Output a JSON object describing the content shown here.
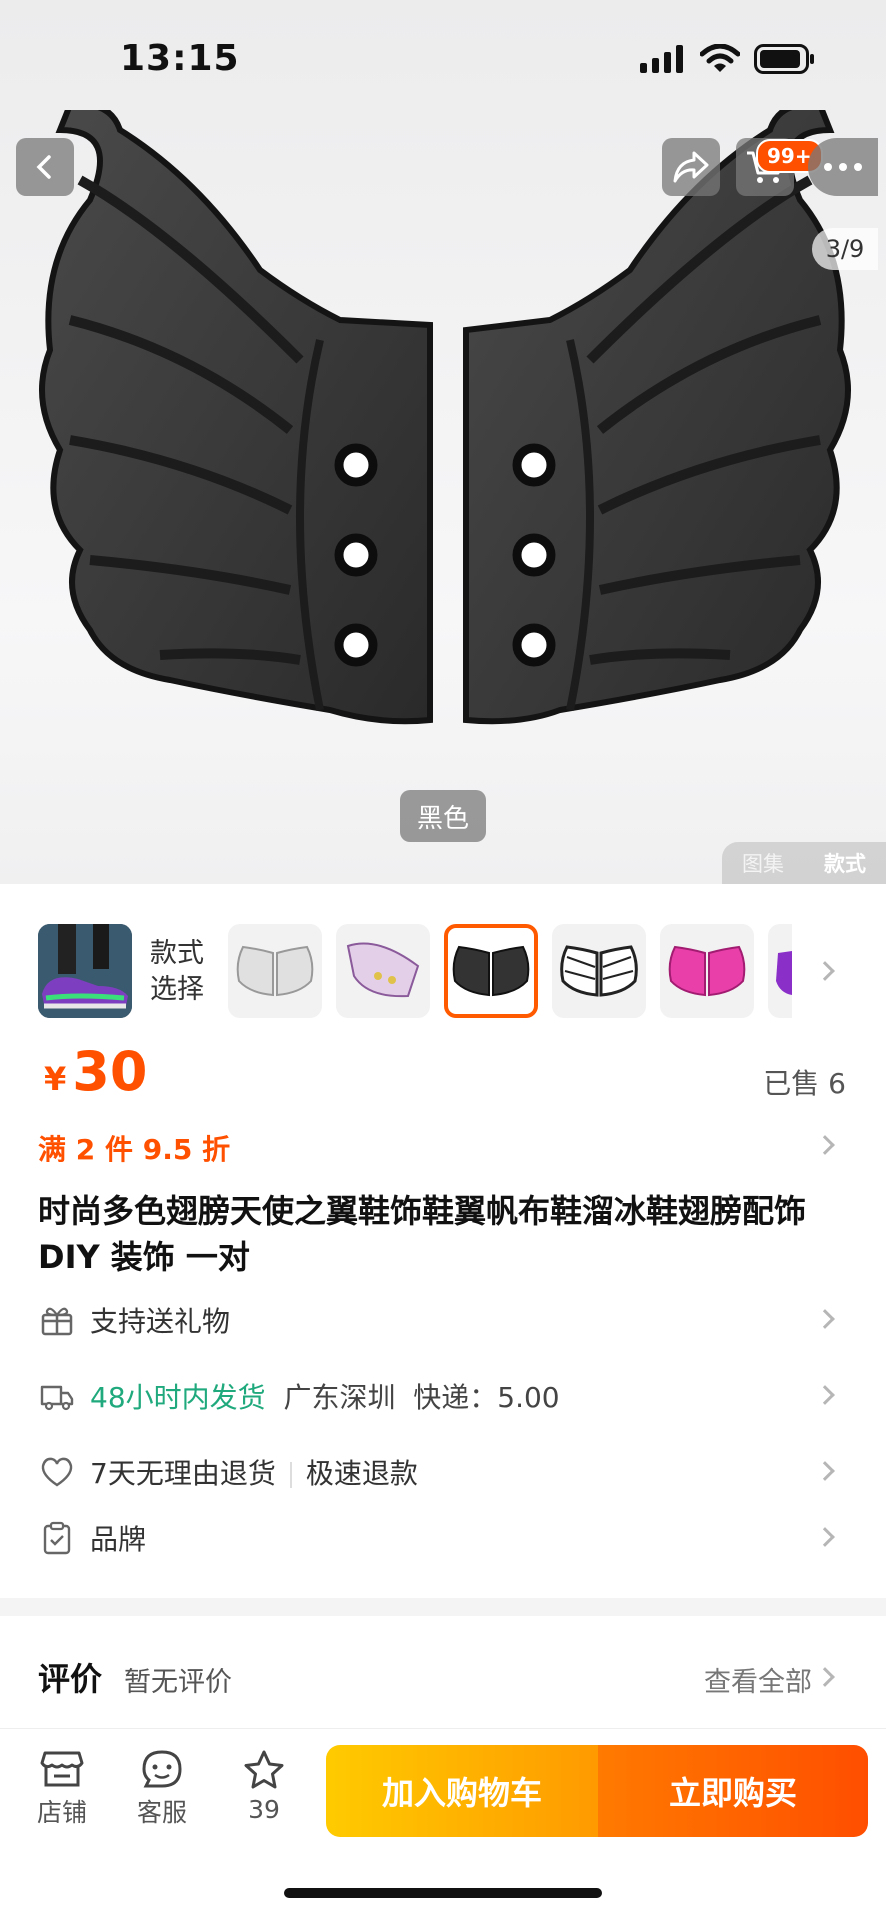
{
  "status_bar": {
    "time": "13:15"
  },
  "gallery": {
    "counter": "3/9",
    "variant_chip": "黑色",
    "tabs": [
      "图集",
      "款式"
    ],
    "cart_badge": "99+"
  },
  "style_selector": {
    "label": "款式\n选择",
    "options": [
      "white-wings",
      "lilac-wings",
      "black-wings",
      "striped-wings",
      "pink-wings",
      "purple-wings"
    ],
    "selected_index": 2
  },
  "price": {
    "currency": "¥",
    "amount": "30",
    "sold": "已售 6"
  },
  "promo": "满 2 件 9.5 折",
  "title": "时尚多色翅膀天使之翼鞋饰鞋翼帆布鞋溜冰鞋翅膀配饰 DIY 装饰 一对",
  "info_rows": {
    "gift": "支持送礼物",
    "shipping_fast": "48小时内发货",
    "shipping_origin": "广东深圳",
    "shipping_fee": "快递：5.00",
    "returns": "7天无理由退货",
    "refund": "极速退款",
    "brand": "品牌"
  },
  "reviews": {
    "title": "评价",
    "status": "暂无评价",
    "view_all": "查看全部"
  },
  "bottom_bar": {
    "shop": "店铺",
    "service": "客服",
    "favorites": "39",
    "add_to_cart": "加入购物车",
    "buy_now": "立即购买"
  },
  "colors": {
    "accent": "#ff5000",
    "green": "#1fa97c"
  }
}
